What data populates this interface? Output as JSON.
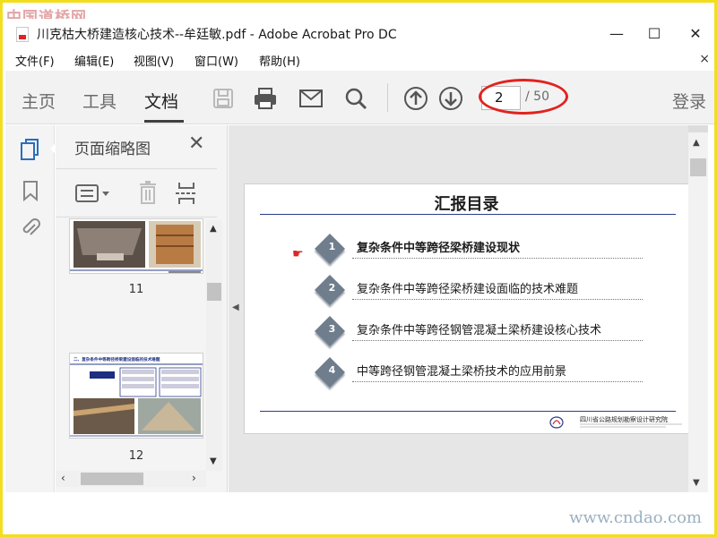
{
  "watermark": {
    "top": "中国道桥网",
    "bottom": "www.cndao.com"
  },
  "window": {
    "title": "川克枯大桥建造核心技术--牟廷敏.pdf - Adobe Acrobat Pro DC",
    "controls": {
      "minimize": "—",
      "maximize": "☐",
      "close": "✕"
    }
  },
  "menu": {
    "items": [
      "文件(F)",
      "编辑(E)",
      "视图(V)",
      "窗口(W)",
      "帮助(H)"
    ],
    "close": "×"
  },
  "toolbar": {
    "tabs": [
      "主页",
      "工具",
      "文档"
    ],
    "active_tab": "文档",
    "icons": [
      "save-icon",
      "print-icon",
      "email-icon",
      "search-icon",
      "page-up-icon",
      "page-down-icon"
    ],
    "current_page": "2",
    "total_pages": "/ 50",
    "login": "登录"
  },
  "thumbnails": {
    "title": "页面缩略图",
    "close": "✕",
    "items": [
      {
        "label": "11"
      },
      {
        "label": "12",
        "heading": "二、复杂条件中等跨径桥梁建设面临的技术难题"
      }
    ]
  },
  "document": {
    "heading": "汇报目录",
    "toc": [
      {
        "num": "1",
        "text": "复杂条件中等跨径梁桥建设现状",
        "current": true
      },
      {
        "num": "2",
        "text": "复杂条件中等跨径梁桥建设面临的技术难题",
        "current": false
      },
      {
        "num": "3",
        "text": "复杂条件中等跨径钢管混凝土梁桥建设核心技术",
        "current": false
      },
      {
        "num": "4",
        "text": "中等跨径钢管混凝土梁桥技术的应用前景",
        "current": false
      }
    ],
    "pointer": "☛",
    "footer_org": "四川省公路规划勘察设计研究院"
  },
  "colors": {
    "accent_blue": "#2a6ebb",
    "annotation_red": "#e0231f",
    "watermark_frame": "#f2de1e"
  }
}
